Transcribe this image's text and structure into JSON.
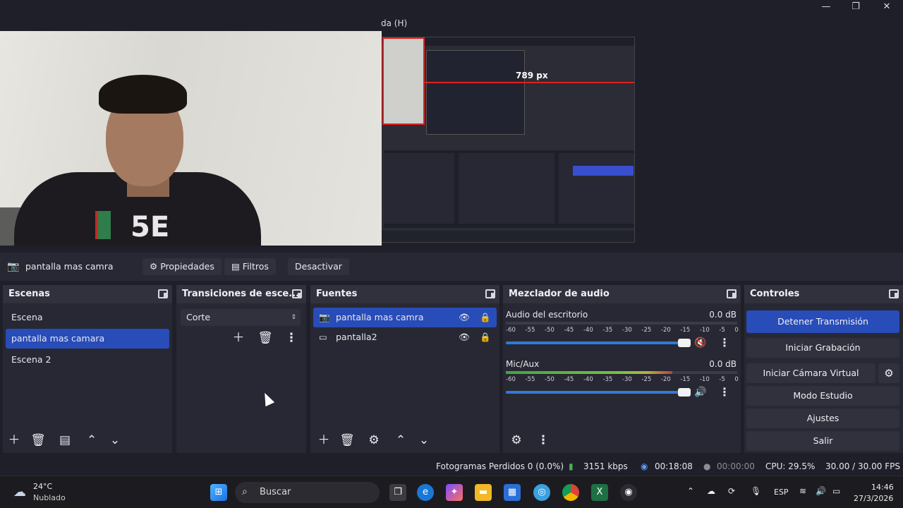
{
  "window": {
    "menu_partial": "da (H)",
    "min_glyph": "—",
    "max_glyph": "❐",
    "close_glyph": "✕"
  },
  "preview": {
    "measure_label": "789 px",
    "webcam_shirt_text": "5E"
  },
  "source_toolbar": {
    "source_name": "pantalla mas camra",
    "properties": "Propiedades",
    "filters": "Filtros",
    "deactivate": "Desactivar"
  },
  "scenes": {
    "title": "Escenas",
    "items": [
      {
        "label": "Escena",
        "selected": false
      },
      {
        "label": "pantalla mas camara",
        "selected": true
      },
      {
        "label": "Escena 2",
        "selected": false
      }
    ]
  },
  "transitions": {
    "title": "Transiciones de esce...",
    "selected": "Corte"
  },
  "sources": {
    "title": "Fuentes",
    "items": [
      {
        "label": "pantalla mas camra",
        "icon": "camera-icon",
        "selected": true
      },
      {
        "label": "pantalla2",
        "icon": "monitor-icon",
        "selected": false
      }
    ]
  },
  "audio": {
    "title": "Mezclador de audio",
    "ticks": [
      "-60",
      "-55",
      "-50",
      "-45",
      "-40",
      "-35",
      "-30",
      "-25",
      "-20",
      "-15",
      "-10",
      "-5",
      "0"
    ],
    "channels": [
      {
        "name": "Audio del escritorio",
        "db": "0.0 dB",
        "level": 0,
        "volume": 0.96,
        "muted": true
      },
      {
        "name": "Mic/Aux",
        "db": "0.0 dB",
        "level": 0.72,
        "volume": 0.96,
        "muted": false
      }
    ]
  },
  "controls": {
    "title": "Controles",
    "stop_stream": "Detener Transmisión",
    "start_recording": "Iniciar Grabación",
    "start_virtual_cam": "Iniciar Cámara Virtual",
    "studio_mode": "Modo Estudio",
    "settings": "Ajustes",
    "exit": "Salir"
  },
  "status": {
    "dropped_frames": "Fotogramas Perdidos 0 (0.0%)",
    "bitrate": "3151 kbps",
    "stream_time": "00:18:08",
    "record_time": "00:00:00",
    "cpu": "CPU: 29.5%",
    "fps": "30.00 / 30.00 FPS"
  },
  "taskbar": {
    "weather_temp": "24°C",
    "weather_desc": "Nublado",
    "search_label": "Buscar",
    "language": "ESP",
    "time": "14:46",
    "date": "27/3/2026"
  },
  "colors": {
    "accent": "#284cb8",
    "bg": "#1e1f29",
    "panel": "#272833",
    "red": "#e02020"
  }
}
